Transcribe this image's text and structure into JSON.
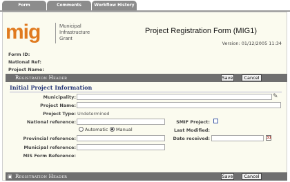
{
  "tabs": [
    {
      "label": "Form"
    },
    {
      "label": "Comments"
    },
    {
      "label": "Workflow History"
    }
  ],
  "logo": {
    "mark": "mig",
    "line1": "Municipal",
    "line2": "Infrastructure",
    "line3": "Grant"
  },
  "header": {
    "title": "Project Registration Form (MIG1)",
    "version": "Version: 01/12/2005 11:34"
  },
  "meta": {
    "form_id_label": "Form ID:",
    "national_ref_label": "National Ref:",
    "project_name_label": "Project Name:"
  },
  "section_bar": {
    "title": "Registration Header",
    "save_label": "Save",
    "cancel_label": "Cancel"
  },
  "section": {
    "heading": "Initial Project Information",
    "fields": {
      "municipality_label": "Municipality:",
      "project_name_label": "Project Name:",
      "project_type_label": "Project Type:",
      "project_type_value": "Undetermined",
      "national_reference_label": "National reference:",
      "radio_automatic": "Automatic",
      "radio_manual": "Manual",
      "selected_reference_mode": "Manual",
      "provincial_reference_label": "Provincial reference:",
      "municipal_reference_label": "Municipal reference:",
      "mis_form_reference_label": "MIS Form Reference:",
      "smif_project_label": "SMIF Project:",
      "last_modified_label": "Last Modified:",
      "date_received_label": "Date received:",
      "date_received_value": "",
      "calendar_icon_text": "31"
    }
  },
  "colors": {
    "brand_orange": "#e07a1f",
    "section_bar": "#6f6f6f",
    "subhead_blue": "#2d3d7a",
    "panel_bg": "#fbfbef"
  }
}
